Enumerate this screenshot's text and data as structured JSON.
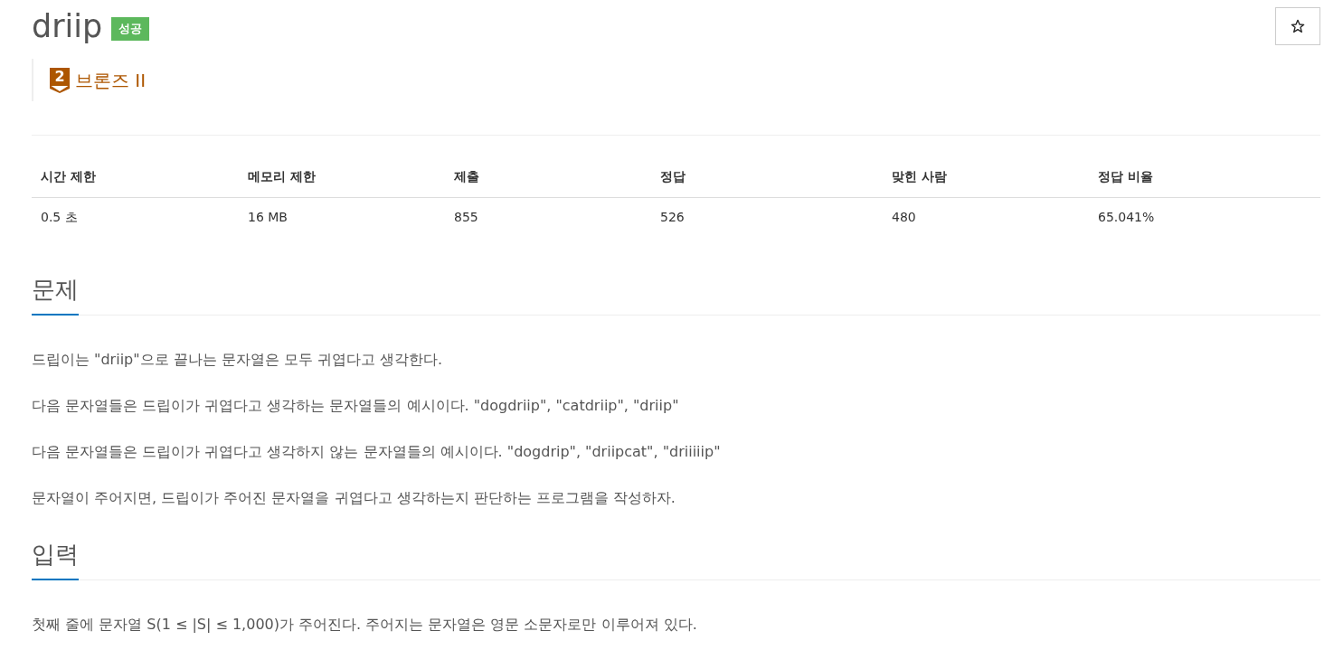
{
  "problem": {
    "title": "driip",
    "result_badge": "성공",
    "starred": false
  },
  "tier": {
    "number": "2",
    "name": "브론즈 II",
    "color": "#ad5600"
  },
  "stats_table": {
    "columns": [
      "시간 제한",
      "메모리 제한",
      "제출",
      "정답",
      "맞힌 사람",
      "정답 비율"
    ],
    "rows": [
      [
        "0.5 초",
        "16 MB",
        "855",
        "526",
        "480",
        "65.041%"
      ]
    ]
  },
  "sections": [
    {
      "heading": "문제",
      "paragraphs": [
        "드립이는 \"driip\"으로 끝나는 문자열은 모두 귀엽다고 생각한다.",
        "다음 문자열들은 드립이가 귀엽다고 생각하는 문자열들의 예시이다. \"dogdriip\", \"catdriip\", \"driip\"",
        "다음 문자열들은 드립이가 귀엽다고 생각하지 않는 문자열들의 예시이다. \"dogdrip\", \"driipcat\", \"driiiiip\"",
        "문자열이 주어지면, 드립이가 주어진 문자열을 귀엽다고 생각하는지 판단하는 프로그램을 작성하자."
      ]
    },
    {
      "heading": "입력",
      "paragraphs": [
        "첫째 줄에 문자열 S(1 ≤ |S| ≤ 1,000)가 주어진다. 주어지는 문자열은 영문 소문자로만 이루어져 있다."
      ]
    }
  ]
}
